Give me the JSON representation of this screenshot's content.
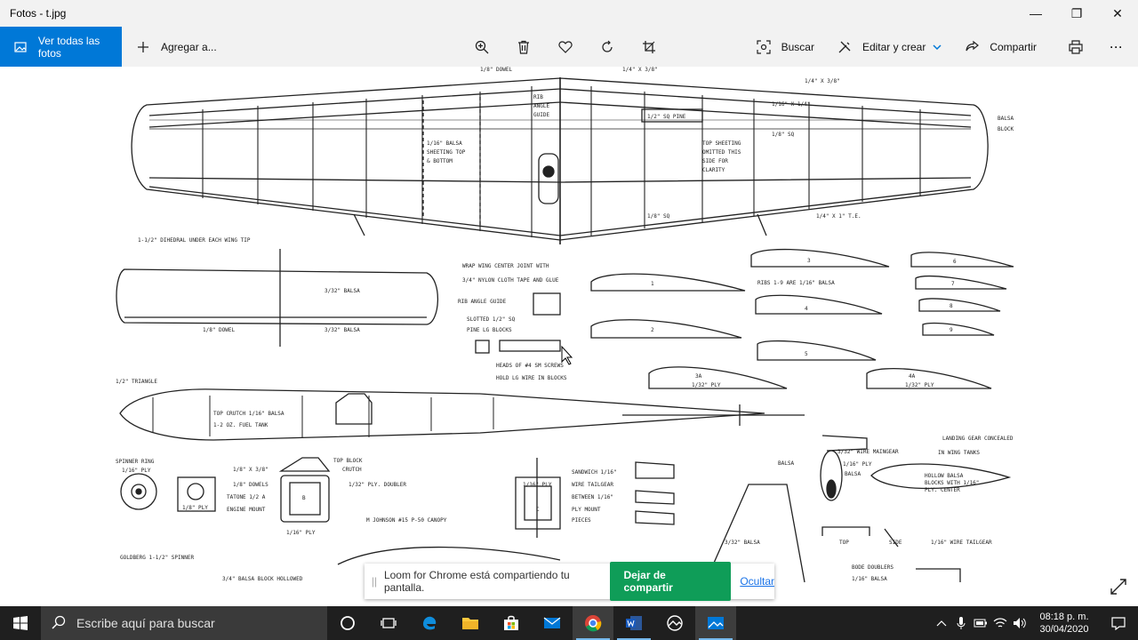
{
  "window": {
    "title": "Fotos - t.jpg",
    "minimize": "—",
    "restore": "❐",
    "close": "✕"
  },
  "toolbar": {
    "all_photos": "Ver todas las fotos",
    "add": "Agregar a...",
    "search": "Buscar",
    "edit_create": "Editar y crear",
    "share": "Compartir",
    "more": "···"
  },
  "blueprint": {
    "dowel_top": "1/8\" DOWEL",
    "top_3_8": "1/4\" X 3/8\"",
    "right_3_8": "1/4\" X 3/8\"",
    "balsa_block": "BALSA",
    "balsa_block2": "BLOCK",
    "rib_angle": "RIB",
    "rib_angle2": "ANGLE",
    "rib_angle3": "GUIDE",
    "pine": "1/2\" SQ PINE",
    "sheet1": "1/16\" BALSA",
    "sheet2": "SHEETING TOP",
    "sheet3": "& BOTTOM",
    "top_sheet1": "TOP SHEETING",
    "top_sheet2": "OMITTED THIS",
    "top_sheet3": "SIDE FOR",
    "top_sheet4": "CLARITY",
    "sq_1_16": "1/16\" X 1/4\"",
    "sq2": "1/8\" SQ",
    "sq3": "1/8\" SQ",
    "te": "1/4\" X 1\" T.E.",
    "dihedral": "1-1/2\" DIHEDRAL UNDER EACH WING TIP",
    "wrap1": "WRAP WING CENTER JOINT WITH",
    "wrap2": "3/4\" NYLON CLOTH TAPE AND GLUE",
    "rib_guide": "RIB ANGLE GUIDE",
    "slotted1": "SLOTTED 1/2\" SQ",
    "slotted2": "PINE LG BLOCKS",
    "heads1": "HEADS OF #4 SM SCREWS",
    "heads2": "HOLD LG WIRE IN BLOCKS",
    "ribs_note": "RIBS 1-9 ARE 1/16\" BALSA",
    "rib1": "1",
    "rib2": "2",
    "rib3": "3",
    "rib4": "4",
    "rib5": "5",
    "rib6": "6",
    "rib7": "7",
    "rib8": "8",
    "rib9": "9",
    "rib3a": "3A",
    "rib3a_ply": "1/32\" PLY",
    "rib4a": "4A",
    "rib4a_ply": "1/32\" PLY",
    "balsa_3_32": "3/32\" BALSA",
    "balsa_3_32b": "3/32\" BALSA",
    "dowel_1_8": "1/8\" DOWEL",
    "triangle": "1/2\" TRIANGLE",
    "crutch": "TOP CRUTCH 1/16\" BALSA",
    "tank": "1-2 OZ. FUEL TANK",
    "spinner_ring": "SPINNER RING",
    "spinner_ply": "1/16\" PLY",
    "x3_8": "1/8\" X 3/8\"",
    "dowels": "1/8\" DOWELS",
    "tatone": "TATONE 1/2 A",
    "engine_mount": "ENGINE MOUNT",
    "ply_1_8": "1/8\" PLY",
    "top_block": "TOP BLOCK",
    "crutch2": "CRUTCH",
    "ply_doubler": "1/32\" PLY. DOUBLER",
    "b_label": "B",
    "ply_1_16": "1/16\" PLY",
    "johnson": "M JOHNSON  #15  P-50 CANOPY",
    "goldberg": "GOLDBERG 1-1/2\" SPINNER",
    "ply_c": "1/16\" PLY",
    "c_label": "C",
    "sandwich1": "SANDWICH 1/16\"",
    "sandwich2": "WIRE TAILGEAR",
    "sandwich3": "BETWEEN 1/16\"",
    "sandwich4": "PLY MOUNT",
    "sandwich5": "PIECES",
    "balsa_3_32c": "3/32\" BALSA",
    "balsa_block_bottom": "3/4\" BALSA BLOCK HOLLOWED",
    "wire_gear": "3/32\" WIRE MAINGEAR",
    "ply_1_16b": "1/16\" PLY",
    "balsa_b": "BALSA",
    "balsa_left": "BALSA",
    "landing1": "LANDING GEAR CONCEALED",
    "landing2": "IN WING TANKS",
    "hollow1": "HOLLOW BALSA",
    "hollow2": "BLOCKS WITH 1/16\"",
    "hollow3": "PLY. CENTER",
    "top_lbl": "TOP",
    "side_lbl": "SIDE",
    "tailgear": "1/16\" WIRE TAILGEAR",
    "doublers": "BODE DOUBLERS",
    "balsa_d": "1/16\" BALSA"
  },
  "loom": {
    "grip": "||",
    "message": "Loom for Chrome está compartiendo tu pantalla.",
    "stop": "Dejar de compartir",
    "hide": "Ocultar"
  },
  "taskbar": {
    "search_placeholder": "Escribe aquí para buscar",
    "time": "08:18 p. m.",
    "date": "30/04/2020"
  }
}
